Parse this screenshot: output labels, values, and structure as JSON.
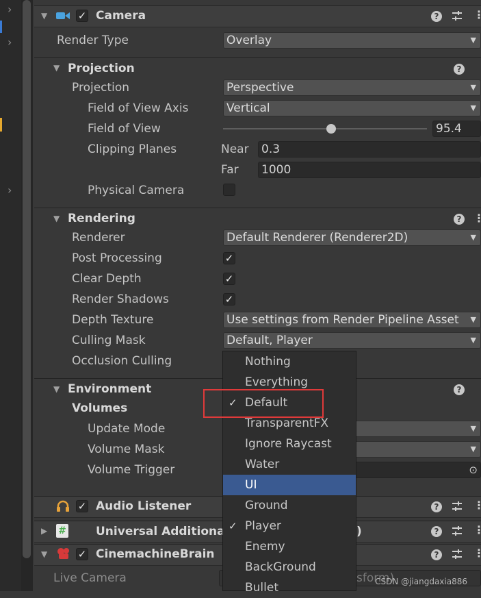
{
  "camera": {
    "title": "Camera",
    "render_type_label": "Render Type",
    "render_type_value": "Overlay"
  },
  "projection": {
    "title": "Projection",
    "projection_label": "Projection",
    "projection_value": "Perspective",
    "fov_axis_label": "Field of View Axis",
    "fov_axis_value": "Vertical",
    "fov_label": "Field of View",
    "fov_value": "95.4",
    "fov_slider_fraction": 0.53,
    "clipping_label": "Clipping Planes",
    "near_label": "Near",
    "near_value": "0.3",
    "far_label": "Far",
    "far_value": "1000",
    "physical_camera_label": "Physical Camera",
    "physical_camera_checked": false
  },
  "rendering": {
    "title": "Rendering",
    "renderer_label": "Renderer",
    "renderer_value": "Default Renderer (Renderer2D)",
    "post_processing_label": "Post Processing",
    "post_processing_checked": true,
    "clear_depth_label": "Clear Depth",
    "clear_depth_checked": true,
    "render_shadows_label": "Render Shadows",
    "render_shadows_checked": true,
    "depth_texture_label": "Depth Texture",
    "depth_texture_value": "Use settings from Render Pipeline Asset",
    "culling_mask_label": "Culling Mask",
    "culling_mask_value": "Default, Player",
    "occlusion_culling_label": "Occlusion Culling"
  },
  "environment": {
    "title": "Environment",
    "volumes_label": "Volumes",
    "update_mode_label": "Update Mode",
    "volume_mask_label": "Volume Mask",
    "volume_trigger_label": "Volume Trigger"
  },
  "components": {
    "audio_listener": "Audio Listener",
    "universal_additional": "Universal Additional",
    "universal_suffix": ")",
    "cinemachine_brain": "CinemachineBrain",
    "live_camera_label": "Live Camera",
    "live_camera_partial": "sform)"
  },
  "culling_menu": {
    "items": [
      {
        "label": "Nothing",
        "checked": false,
        "selected": false
      },
      {
        "label": "Everything",
        "checked": false,
        "selected": false
      },
      {
        "label": "Default",
        "checked": true,
        "selected": false
      },
      {
        "label": "TransparentFX",
        "checked": false,
        "selected": false
      },
      {
        "label": "Ignore Raycast",
        "checked": false,
        "selected": false
      },
      {
        "label": "Water",
        "checked": false,
        "selected": false
      },
      {
        "label": "UI",
        "checked": false,
        "selected": true
      },
      {
        "label": "Ground",
        "checked": false,
        "selected": false
      },
      {
        "label": "Player",
        "checked": true,
        "selected": false
      },
      {
        "label": "Enemy",
        "checked": false,
        "selected": false
      },
      {
        "label": "BackGround",
        "checked": false,
        "selected": false
      },
      {
        "label": "Bullet",
        "checked": false,
        "selected": false
      }
    ],
    "checkmark": "✓"
  },
  "icons": {
    "help": "?",
    "menu_dots": "⋮",
    "settings": "⇵",
    "collapse": "▼",
    "expand": "▶",
    "dropdown": "▼",
    "check": "✓",
    "target": "⊙",
    "chevron_right": "›"
  },
  "watermark": "CSDN @jiangdaxia886",
  "colors": {
    "background": "#383838",
    "header": "#3e3e3e",
    "selected": "#3a5a91",
    "highlight_box": "#e03a3a",
    "camera_icon": "#4aa3e0",
    "audio_icon": "#e8a33a",
    "script_icon": "#4caf50",
    "cinemachine_icon": "#d63a3a"
  }
}
